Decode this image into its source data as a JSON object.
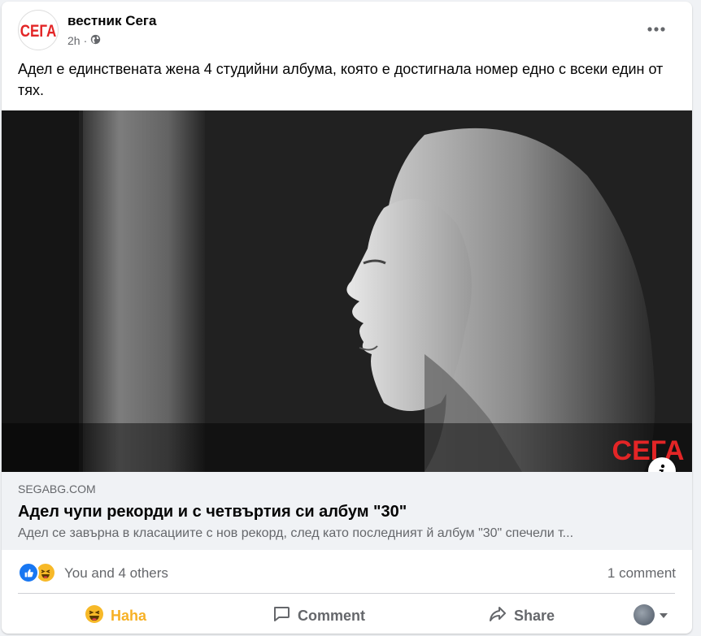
{
  "post": {
    "page_name": "вестник Сега",
    "avatar_text": "СЕГА",
    "time": "2h",
    "audience_icon": "globe-icon",
    "text": "Адел е единствената жена 4 студийни албума, която е достигнала номер едно с всеки един от тях.",
    "photo_watermark": "СЕГА"
  },
  "link": {
    "domain": "SEGABG.COM",
    "title": "Адел чупи рекорди и с четвъртия си албум \"30\"",
    "description": "Адел се завърна в класациите с нов рекорд, след като последният й албум \"30\" спечели т..."
  },
  "reactions": {
    "summary": "You and 4 others",
    "comments": "1 comment",
    "icons": [
      "like-icon",
      "haha-icon"
    ]
  },
  "actions": {
    "haha_label": "Haha",
    "comment_label": "Comment",
    "share_label": "Share"
  },
  "colors": {
    "brand_red": "#e32526",
    "haha_yellow": "#f7b125",
    "like_blue": "#1877f2",
    "muted": "#65676b"
  }
}
